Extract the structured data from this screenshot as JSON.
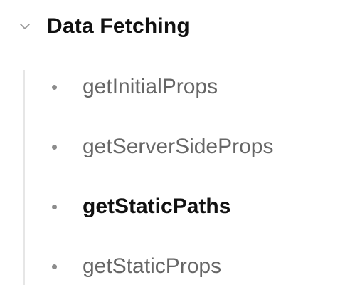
{
  "section": {
    "title": "Data Fetching",
    "expanded": true,
    "chevron_icon": "chevron-down-icon"
  },
  "items": [
    {
      "label": "getInitialProps",
      "active": false
    },
    {
      "label": "getServerSideProps",
      "active": false
    },
    {
      "label": "getStaticPaths",
      "active": true
    },
    {
      "label": "getStaticProps",
      "active": false
    }
  ],
  "colors": {
    "active_text": "#111111",
    "inactive_text": "#666666",
    "bullet": "#8c8c8c",
    "rail": "#e6e6e6"
  }
}
